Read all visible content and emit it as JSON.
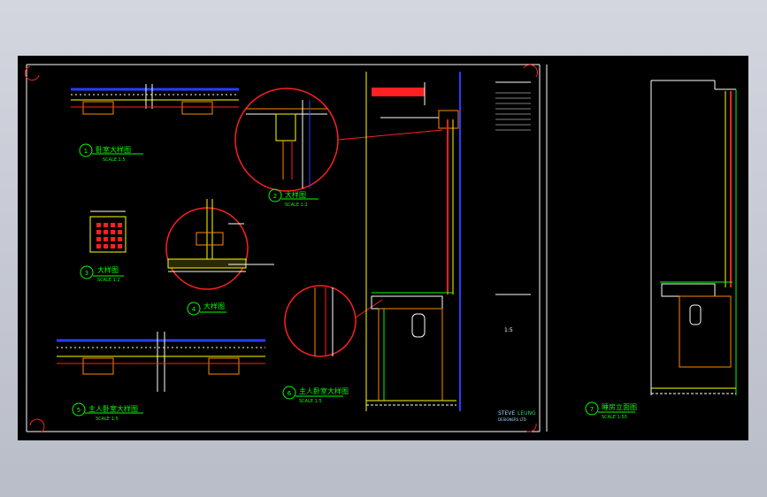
{
  "drawing": {
    "callouts": [
      {
        "id": "1",
        "title": "卧室大样图",
        "scale": "SCALE 1:5"
      },
      {
        "id": "2",
        "title": "大样图",
        "scale": "SCALE 1:2"
      },
      {
        "id": "3",
        "title": "大样图",
        "scale": "SCALE 1:2"
      },
      {
        "id": "4",
        "title": "大样图",
        "scale": ""
      },
      {
        "id": "5",
        "title": "主人卧室大样图",
        "scale": "SCALE 1:5"
      },
      {
        "id": "6",
        "title": "主人卧室大样图",
        "scale": "SCALE 1:5"
      },
      {
        "id": "7",
        "title": "睡房立面图",
        "scale": "SCALE 1:50"
      }
    ],
    "title_block": {
      "brand_a": "STEVE",
      "brand_b": "LEUNG",
      "brand_sub": "DESIGNERS LTD",
      "scale_value": "1:5"
    },
    "colors": {
      "background": "#000000",
      "wall": "#ff2020",
      "dim": "#ffff00",
      "detail": "#00ff00",
      "accent": "#ff8800",
      "line": "#ffffff",
      "border": "#2c3cff"
    }
  }
}
